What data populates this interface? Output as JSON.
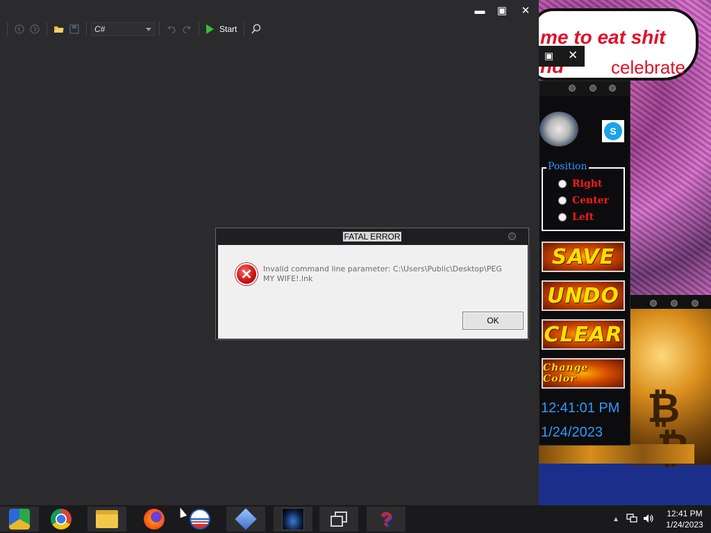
{
  "ide": {
    "language": "C#",
    "start_label": "Start",
    "icons": [
      "back-icon",
      "forward-icon",
      "open-folder-icon",
      "save-icon",
      "undo-icon",
      "redo-icon",
      "play-icon",
      "search-icon"
    ]
  },
  "wallpaper": {
    "speech_line1": "me to eat shit",
    "speech_line2a": "nd",
    "speech_line2b": "celebrate"
  },
  "tool_window": {
    "position_label": "Position",
    "options": [
      "Right",
      "Center",
      "Left"
    ],
    "buttons": {
      "save": "SAVE",
      "undo": "UNDO",
      "clear": "CLEAR",
      "change_color": "Change Color"
    },
    "time": "12:41:01 PM",
    "date": "1/24/2023"
  },
  "dialog": {
    "title": "FATAL ERROR",
    "message": "Invalid command line parameter: C:\\Users\\Public\\Desktop\\PEG MY WIFE!.lnk",
    "ok_label": "OK"
  },
  "taskbar": {
    "apps": [
      "chromium",
      "chrome",
      "file-explorer",
      "firefox",
      "obama-app",
      "diamond-app",
      "rocket-app",
      "task-view",
      "questionmark-app"
    ],
    "time": "12:41 PM",
    "date": "1/24/2023"
  },
  "colors": {
    "accent_blue": "#2f9aff",
    "error_red": "#d31414",
    "label_red": "#ff1a1a",
    "button_yellow": "#ffe000"
  }
}
